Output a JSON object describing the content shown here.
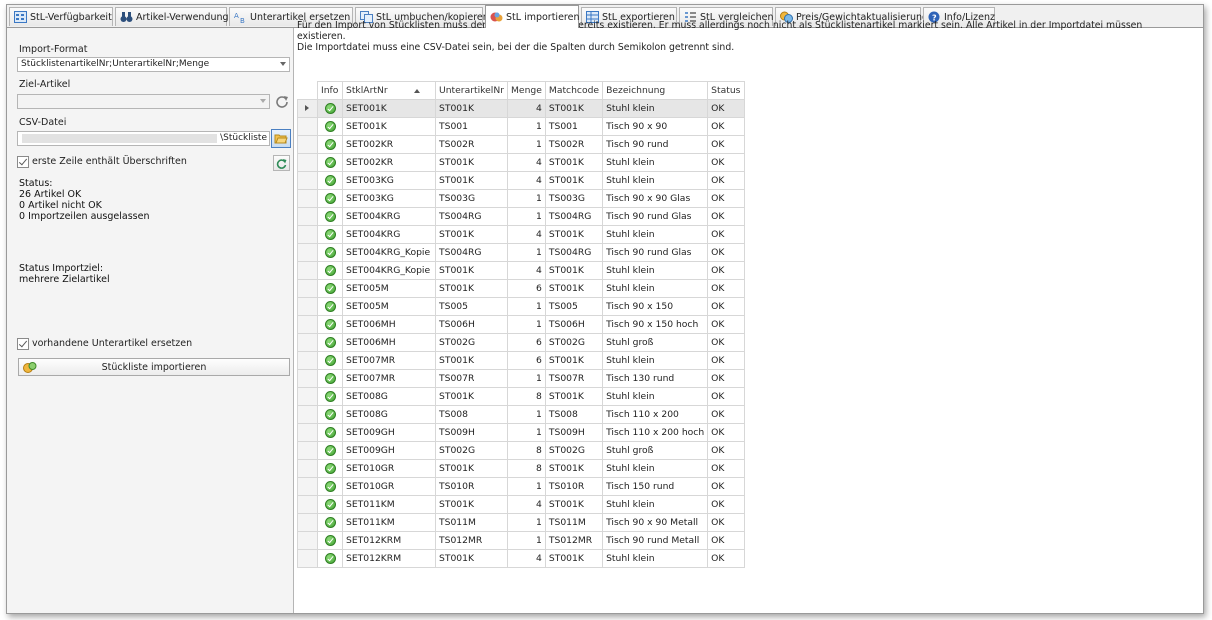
{
  "tabs": [
    {
      "label": "StL-Verfügbarkeit",
      "icon": "availability-grid-icon"
    },
    {
      "label": "Artikel-Verwendung",
      "icon": "binoculars-icon"
    },
    {
      "label": "Unterartikel ersetzen",
      "icon": "replace-ab-icon"
    },
    {
      "label": "StL umbuchen/kopieren",
      "icon": "copy-icon"
    },
    {
      "label": "StL importieren",
      "icon": "import-icon"
    },
    {
      "label": "StL exportieren",
      "icon": "export-icon"
    },
    {
      "label": "StL vergleichen",
      "icon": "compare-list-icon"
    },
    {
      "label": "Preis/Gewichtaktualisierung",
      "icon": "price-coins-icon"
    },
    {
      "label": "Info/Lizenz",
      "icon": "info-icon"
    }
  ],
  "left": {
    "import_format_label": "Import-Format",
    "import_format_value": "StücklistenartikelNr;UnterartikelNr;Menge",
    "ziel_artikel_label": "Ziel-Artikel",
    "ziel_artikel_value": "",
    "csv_label": "CSV-Datei",
    "csv_value": "\\Stückliste",
    "header_checkbox_label": "erste Zeile enthält Überschriften",
    "status_title": "Status:",
    "status_ok": "26 Artikel OK",
    "status_not_ok": "0 Artikel nicht OK",
    "status_skipped": "0 Importzeilen ausgelassen",
    "status_import_title": "Status Importziel:",
    "status_import_value": "mehrere Zielartikel",
    "replace_checkbox_label": "vorhandene Unterartikel ersetzen",
    "import_button_label": "Stückliste importieren"
  },
  "hint": {
    "line1": "Für den Import von Stücklisten muss der Stücklistenartikel bereits existieren. Er muss allerdings noch nicht als Stücklistenartikel markiert sein. Alle Artikel in der Importdatei müssen existieren.",
    "line2": "Die Importdatei muss eine CSV-Datei sein, bei der die Spalten durch Semikolon getrennt sind."
  },
  "table": {
    "columns": [
      "Info",
      "StklArtNr",
      "UnterartikelNr",
      "Menge",
      "Matchcode",
      "Bezeichnung",
      "Status"
    ],
    "rows": [
      [
        "SET001K",
        "ST001K",
        "4",
        "ST001K",
        "Stuhl klein",
        "OK"
      ],
      [
        "SET001K",
        "TS001",
        "1",
        "TS001",
        "Tisch 90 x 90",
        "OK"
      ],
      [
        "SET002KR",
        "TS002R",
        "1",
        "TS002R",
        "Tisch 90 rund",
        "OK"
      ],
      [
        "SET002KR",
        "ST001K",
        "4",
        "ST001K",
        "Stuhl klein",
        "OK"
      ],
      [
        "SET003KG",
        "ST001K",
        "4",
        "ST001K",
        "Stuhl klein",
        "OK"
      ],
      [
        "SET003KG",
        "TS003G",
        "1",
        "TS003G",
        "Tisch 90 x 90 Glas",
        "OK"
      ],
      [
        "SET004KRG",
        "TS004RG",
        "1",
        "TS004RG",
        "Tisch 90 rund Glas",
        "OK"
      ],
      [
        "SET004KRG",
        "ST001K",
        "4",
        "ST001K",
        "Stuhl klein",
        "OK"
      ],
      [
        "SET004KRG_Kopie",
        "TS004RG",
        "1",
        "TS004RG",
        "Tisch 90 rund Glas",
        "OK"
      ],
      [
        "SET004KRG_Kopie",
        "ST001K",
        "4",
        "ST001K",
        "Stuhl klein",
        "OK"
      ],
      [
        "SET005M",
        "ST001K",
        "6",
        "ST001K",
        "Stuhl klein",
        "OK"
      ],
      [
        "SET005M",
        "TS005",
        "1",
        "TS005",
        "Tisch 90 x 150",
        "OK"
      ],
      [
        "SET006MH",
        "TS006H",
        "1",
        "TS006H",
        "Tisch 90 x 150 hoch",
        "OK"
      ],
      [
        "SET006MH",
        "ST002G",
        "6",
        "ST002G",
        "Stuhl groß",
        "OK"
      ],
      [
        "SET007MR",
        "ST001K",
        "6",
        "ST001K",
        "Stuhl klein",
        "OK"
      ],
      [
        "SET007MR",
        "TS007R",
        "1",
        "TS007R",
        "Tisch 130 rund",
        "OK"
      ],
      [
        "SET008G",
        "ST001K",
        "8",
        "ST001K",
        "Stuhl klein",
        "OK"
      ],
      [
        "SET008G",
        "TS008",
        "1",
        "TS008",
        "Tisch 110 x 200",
        "OK"
      ],
      [
        "SET009GH",
        "TS009H",
        "1",
        "TS009H",
        "Tisch 110 x 200 hoch",
        "OK"
      ],
      [
        "SET009GH",
        "ST002G",
        "8",
        "ST002G",
        "Stuhl groß",
        "OK"
      ],
      [
        "SET010GR",
        "ST001K",
        "8",
        "ST001K",
        "Stuhl klein",
        "OK"
      ],
      [
        "SET010GR",
        "TS010R",
        "1",
        "TS010R",
        "Tisch 150 rund",
        "OK"
      ],
      [
        "SET011KM",
        "ST001K",
        "4",
        "ST001K",
        "Stuhl klein",
        "OK"
      ],
      [
        "SET011KM",
        "TS011M",
        "1",
        "TS011M",
        "Tisch 90 x 90 Metall",
        "OK"
      ],
      [
        "SET012KRM",
        "TS012MR",
        "1",
        "TS012MR",
        "Tisch 90 rund Metall",
        "OK"
      ],
      [
        "SET012KRM",
        "ST001K",
        "4",
        "ST001K",
        "Stuhl klein",
        "OK"
      ]
    ]
  }
}
